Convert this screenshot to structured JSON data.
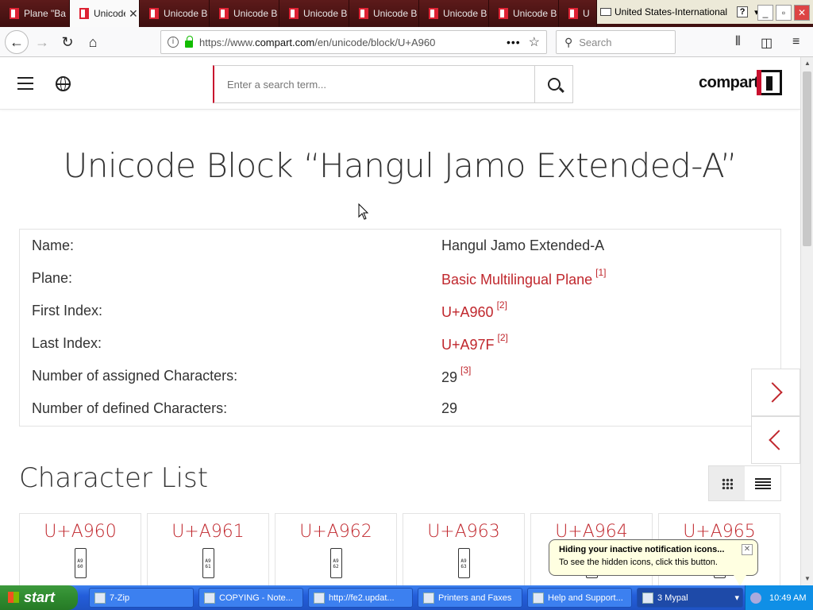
{
  "browser": {
    "tabs": [
      {
        "title": "Plane \"Ba",
        "active": false
      },
      {
        "title": "Unicode",
        "active": true
      },
      {
        "title": "Unicode B",
        "active": false
      },
      {
        "title": "Unicode B",
        "active": false
      },
      {
        "title": "Unicode B",
        "active": false
      },
      {
        "title": "Unicode B",
        "active": false
      },
      {
        "title": "Unicode B",
        "active": false
      },
      {
        "title": "Unicode B",
        "active": false
      },
      {
        "title": "U",
        "active": false
      }
    ],
    "tab_close": "✕",
    "keyboard_layout": "United States-International",
    "help_glyph": "?",
    "window_buttons": {
      "minimize": "_",
      "maximize": "▫",
      "close": "✕"
    },
    "url_prefix": "https://www.",
    "url_domain": "compart.com",
    "url_path": "/en/unicode/block/U+A960",
    "search_placeholder": "Search"
  },
  "site": {
    "search_placeholder": "Enter a search term...",
    "logo_text": "compart"
  },
  "page": {
    "title": "Unicode Block “Hangul Jamo Extended-A”",
    "info_rows": [
      {
        "label": "Name:",
        "value": "Hangul Jamo Extended-A",
        "link": false,
        "ref": ""
      },
      {
        "label": "Plane:",
        "value": "Basic Multilingual Plane",
        "link": true,
        "ref": "[1]"
      },
      {
        "label": "First Index:",
        "value": "U+A960",
        "link": true,
        "ref": "[2]"
      },
      {
        "label": "Last Index:",
        "value": "U+A97F",
        "link": true,
        "ref": "[2]"
      },
      {
        "label": "Number of assigned Characters:",
        "value": "29",
        "link": false,
        "ref": "[3]"
      },
      {
        "label": "Number of defined Characters:",
        "value": "29",
        "link": false,
        "ref": ""
      }
    ],
    "char_list_title": "Character List",
    "characters": [
      {
        "code": "U+A960",
        "glyph": "A9 60"
      },
      {
        "code": "U+A961",
        "glyph": "A9 61"
      },
      {
        "code": "U+A962",
        "glyph": "A9 62"
      },
      {
        "code": "U+A963",
        "glyph": "A9 63"
      },
      {
        "code": "U+A964",
        "glyph": ""
      },
      {
        "code": "U+A965",
        "glyph": ""
      }
    ]
  },
  "tooltip": {
    "title": "Hiding your inactive notification icons...",
    "body": "To see the hidden icons, click this button.",
    "close": "✕"
  },
  "taskbar": {
    "start_label": "start",
    "tasks": [
      {
        "label": "7-Zip",
        "active": false
      },
      {
        "label": "COPYING - Note...",
        "active": false
      },
      {
        "label": "http://fe2.updat...",
        "active": false
      },
      {
        "label": "Printers and Faxes",
        "active": false
      },
      {
        "label": "Help and Support...",
        "active": false
      },
      {
        "label": "3 Mypal",
        "active": true
      }
    ],
    "clock": "10:49 AM"
  },
  "colors": {
    "accent": "#c0272d",
    "xp_blue": "#245edb",
    "xp_green": "#2f8a2f"
  }
}
